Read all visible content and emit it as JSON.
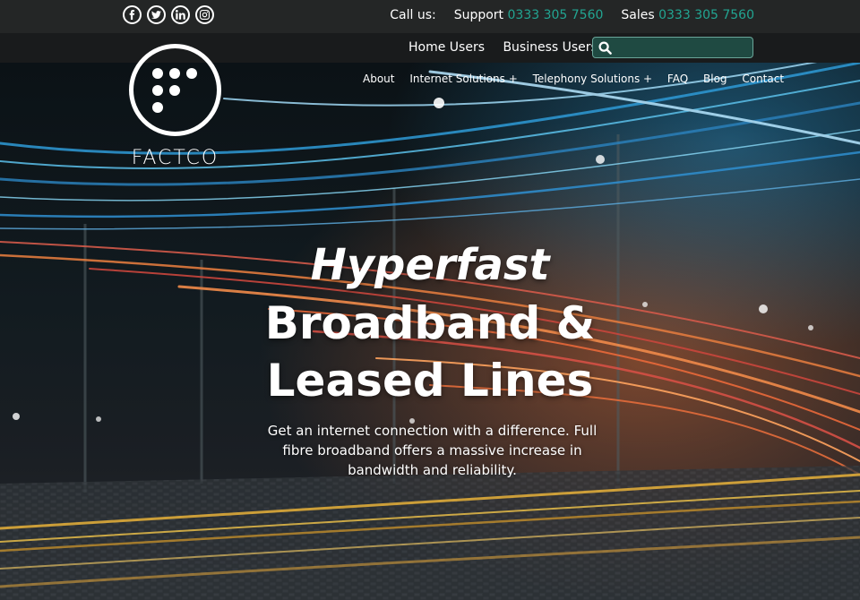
{
  "topbar": {
    "socials": [
      {
        "icon": "facebook-icon"
      },
      {
        "icon": "twitter-icon"
      },
      {
        "icon": "linkedin-icon"
      },
      {
        "icon": "instagram-icon"
      }
    ],
    "call_us": "Call us:",
    "support_label": "Support",
    "support_phone": "0333 305 7560",
    "sales_label": "Sales",
    "sales_phone": "0333 305 7560"
  },
  "subnav": {
    "home_users": "Home Users",
    "business_users": "Business Users",
    "search_value": "",
    "search_icon": "search-icon"
  },
  "logo": {
    "text": "FACTCO"
  },
  "mainnav": [
    {
      "label": "About"
    },
    {
      "label": "Internet Solutions +"
    },
    {
      "label": "Telephony Solutions +"
    },
    {
      "label": "FAQ"
    },
    {
      "label": "Blog"
    },
    {
      "label": "Contact"
    }
  ],
  "hero": {
    "italic": "Hyperfast",
    "line1": "Broadband &",
    "line2": "Leased Lines",
    "lead": "Get an internet connection with a difference. Full fibre broadband offers a massive increase in bandwidth and reliability."
  },
  "colors": {
    "accent": "#22a592",
    "topbar": "#242626",
    "subbar": "#191b1c",
    "search_bg": "#1f4a42"
  }
}
